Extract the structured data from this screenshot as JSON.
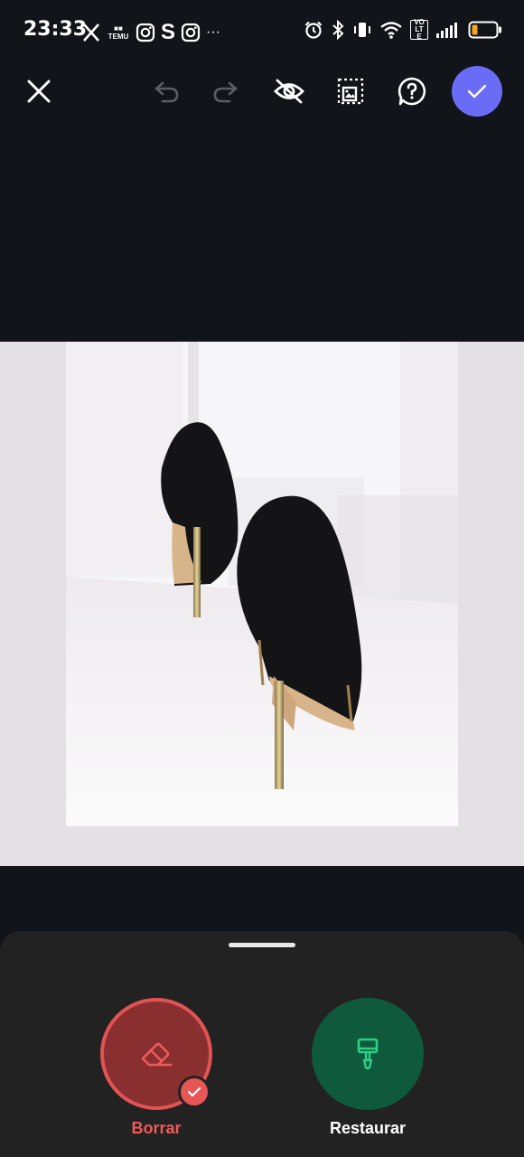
{
  "status_bar": {
    "time": "23:33",
    "left_icons": [
      "x-icon",
      "temu-icon",
      "instagram-icon",
      "shazam-icon",
      "instagram-icon",
      "more-dots-icon"
    ],
    "right_icons": [
      "alarm-icon",
      "bluetooth-icon",
      "vibrate-icon",
      "wifi-icon",
      "volte-icon",
      "signal-icon",
      "battery-icon"
    ],
    "temu_text": "TEMU",
    "volte_text": "VO LTE",
    "more_text": "···"
  },
  "toolbar": {
    "close": "close-icon",
    "undo": "undo-icon",
    "redo": "redo-icon",
    "hide": "eye-off-icon",
    "crop": "image-crop-icon",
    "help": "help-icon",
    "confirm": "check-icon"
  },
  "colors": {
    "background": "#111418",
    "accent": "#6b6cf6",
    "erase": "#ee5a5a",
    "restore": "#0f5a3c",
    "restore_icon": "#2ecf86",
    "panel": "#222222"
  },
  "tools": {
    "erase_label": "Borrar",
    "restore_label": "Restaurar",
    "active": "Borrar"
  }
}
